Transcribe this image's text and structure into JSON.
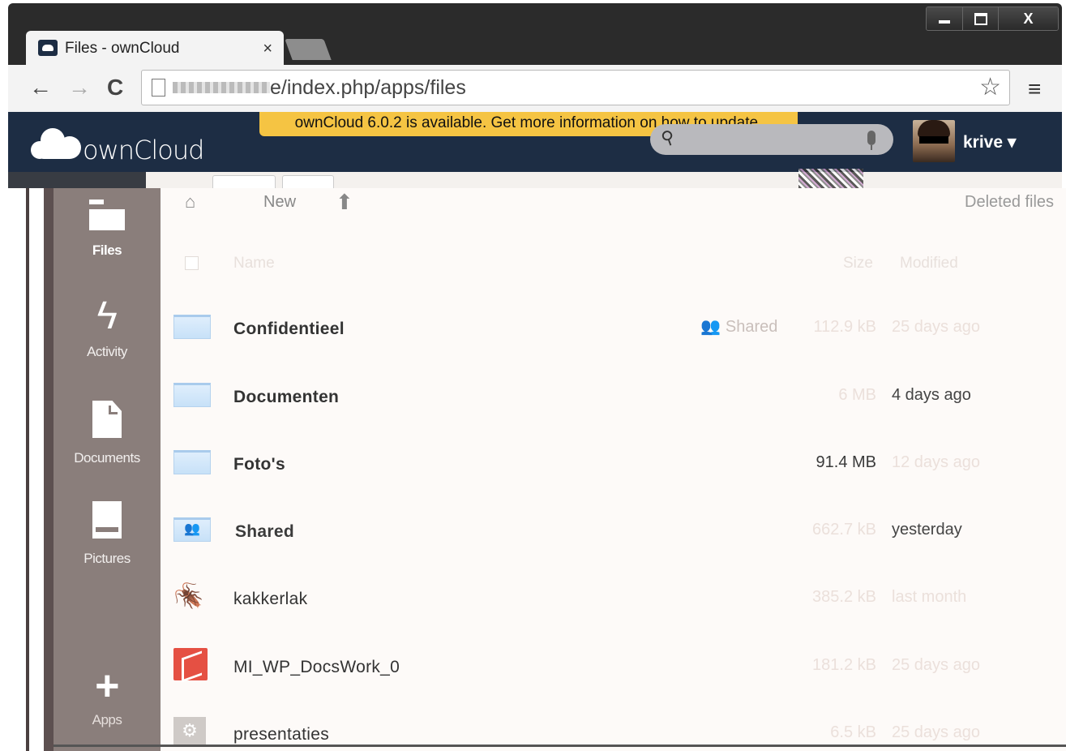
{
  "browser": {
    "tab_title": "Files - ownCloud",
    "tab_close": "×",
    "url_visible": "e/index.php/apps/files",
    "back": "←",
    "forward": "→",
    "reload": "C",
    "star": "☆",
    "menu": "≡",
    "window_controls": {
      "close": "X"
    }
  },
  "header": {
    "logo_text": "ownCloud",
    "update_notice": "ownCloud 6.0.2 is available. Get more information on how to update.",
    "user": "krive ▾"
  },
  "nav": {
    "items": [
      {
        "label": "Files",
        "icon": "folder-icon",
        "active": true
      },
      {
        "label": "Activity",
        "icon": "bolt-icon"
      },
      {
        "label": "Documents",
        "icon": "document-icon"
      },
      {
        "label": "Pictures",
        "icon": "pictures-icon"
      },
      {
        "label": "Apps",
        "icon": "plus-icon"
      }
    ]
  },
  "controls": {
    "new_label": "New",
    "deleted_files": "Deleted files"
  },
  "table": {
    "headers": {
      "name": "Name",
      "size": "Size",
      "modified": "Modified"
    },
    "rows": [
      {
        "name": "Confidentieel",
        "type": "folder",
        "shared_label": "Shared",
        "size": "112.9 kB",
        "modified": "25 days ago"
      },
      {
        "name": "Documenten",
        "type": "folder",
        "size": "6 MB",
        "modified": "4 days ago"
      },
      {
        "name": "Foto's",
        "type": "folder",
        "size": "91.4 MB",
        "modified": "12 days ago"
      },
      {
        "name": "Shared",
        "type": "shared-folder",
        "size": "662.7 kB",
        "modified": "yesterday"
      },
      {
        "name": "kakkerlak",
        "type": "image",
        "size": "385.2 kB",
        "modified": "last month"
      },
      {
        "name": "MI_WP_DocsWork_0",
        "type": "pdf",
        "size": "181.2 kB",
        "modified": "25 days ago"
      },
      {
        "name": "presentaties",
        "type": "file",
        "size": "6.5 kB",
        "modified": "25 days ago"
      }
    ]
  },
  "colors": {
    "header_bg": "#1d2d44",
    "nav_bg": "#8a7e7b",
    "update_bg": "#f5c443",
    "content_bg": "#fdfaf8"
  }
}
